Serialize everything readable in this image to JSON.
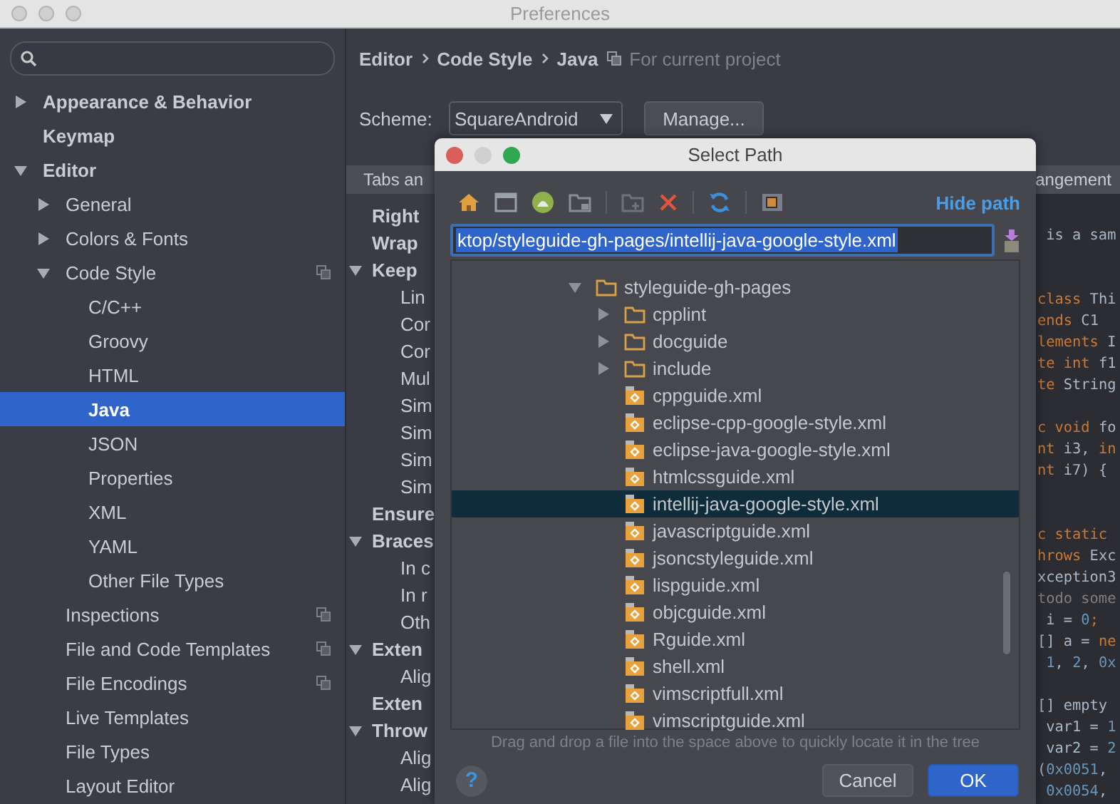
{
  "window": {
    "title": "Preferences"
  },
  "sidebar": {
    "items": [
      {
        "label": "Appearance & Behavior",
        "expanded": false,
        "selected": false,
        "project_scope": false
      },
      {
        "label": "Keymap",
        "selected": false,
        "project_scope": false
      },
      {
        "label": "Editor",
        "expanded": true,
        "selected": false,
        "project_scope": false,
        "children": [
          {
            "label": "General",
            "expanded": false,
            "selected": false,
            "project_scope": false
          },
          {
            "label": "Colors & Fonts",
            "expanded": false,
            "selected": false,
            "project_scope": false
          },
          {
            "label": "Code Style",
            "expanded": true,
            "selected": false,
            "project_scope": true,
            "children": [
              {
                "label": "C/C++",
                "selected": false,
                "project_scope": false
              },
              {
                "label": "Groovy",
                "selected": false,
                "project_scope": false
              },
              {
                "label": "HTML",
                "selected": false,
                "project_scope": false
              },
              {
                "label": "Java",
                "selected": true,
                "project_scope": false
              },
              {
                "label": "JSON",
                "selected": false,
                "project_scope": false
              },
              {
                "label": "Properties",
                "selected": false,
                "project_scope": false
              },
              {
                "label": "XML",
                "selected": false,
                "project_scope": false
              },
              {
                "label": "YAML",
                "selected": false,
                "project_scope": false
              },
              {
                "label": "Other File Types",
                "selected": false,
                "project_scope": false
              }
            ]
          },
          {
            "label": "Inspections",
            "selected": false,
            "project_scope": true
          },
          {
            "label": "File and Code Templates",
            "selected": false,
            "project_scope": true
          },
          {
            "label": "File Encodings",
            "selected": false,
            "project_scope": true
          },
          {
            "label": "Live Templates",
            "selected": false,
            "project_scope": false
          },
          {
            "label": "File Types",
            "selected": false,
            "project_scope": false
          },
          {
            "label": "Layout Editor",
            "selected": false,
            "project_scope": false
          }
        ]
      }
    ]
  },
  "breadcrumb": [
    "Editor",
    "Code Style",
    "Java"
  ],
  "scope_note": "For current project",
  "scheme": {
    "label": "Scheme:",
    "value": "SquareAndroid",
    "manage_button": "Manage..."
  },
  "tabs": [
    {
      "label": "Tabs an",
      "selected": false
    },
    {
      "label": "angement",
      "selected": false
    }
  ],
  "settings": [
    {
      "label": "Right"
    },
    {
      "label": "Wrap"
    },
    {
      "label": "Keep",
      "expanded": true,
      "children": [
        {
          "label": "Lin"
        },
        {
          "label": "Cor"
        },
        {
          "label": "Cor"
        },
        {
          "label": "Mul"
        },
        {
          "label": "Sim"
        },
        {
          "label": "Sim"
        },
        {
          "label": "Sim"
        },
        {
          "label": "Sim"
        }
      ]
    },
    {
      "label": "Ensure"
    },
    {
      "label": "Braces",
      "expanded": true,
      "children": [
        {
          "label": "In c"
        },
        {
          "label": "In r"
        },
        {
          "label": "Oth"
        }
      ]
    },
    {
      "label": "Exten",
      "expanded": true,
      "children": [
        {
          "label": "Alig"
        }
      ]
    },
    {
      "label": "Exten"
    },
    {
      "label": "Throw",
      "expanded": true,
      "children": [
        {
          "label": "Alig"
        },
        {
          "label": "Alig"
        }
      ]
    }
  ],
  "code_lines": [
    {
      "kind": "code",
      "segments": [
        {
          "kind": "plain",
          "text": " is a sam"
        }
      ]
    },
    {
      "kind": "blank"
    },
    {
      "kind": "blank"
    },
    {
      "kind": "code",
      "segments": [
        {
          "kind": "keyword",
          "text": "class"
        },
        {
          "kind": "plain",
          "text": " Thi"
        }
      ]
    },
    {
      "kind": "code",
      "segments": [
        {
          "kind": "keyword",
          "text": "ends"
        },
        {
          "kind": "plain",
          "text": " C1"
        }
      ]
    },
    {
      "kind": "code",
      "segments": [
        {
          "kind": "keyword",
          "text": "lements"
        },
        {
          "kind": "plain",
          "text": " I"
        }
      ]
    },
    {
      "kind": "code",
      "segments": [
        {
          "kind": "keyword",
          "text": "te int"
        },
        {
          "kind": "plain",
          "text": " f1"
        }
      ]
    },
    {
      "kind": "code",
      "segments": [
        {
          "kind": "keyword",
          "text": "te"
        },
        {
          "kind": "plain",
          "text": " String"
        }
      ]
    },
    {
      "kind": "blank"
    },
    {
      "kind": "code",
      "segments": [
        {
          "kind": "keyword",
          "text": "c void"
        },
        {
          "kind": "plain",
          "text": " fo"
        }
      ]
    },
    {
      "kind": "code",
      "segments": [
        {
          "kind": "keyword",
          "text": "nt"
        },
        {
          "kind": "plain",
          "text": " i3, "
        },
        {
          "kind": "keyword",
          "text": "in"
        }
      ]
    },
    {
      "kind": "code",
      "segments": [
        {
          "kind": "keyword",
          "text": "nt"
        },
        {
          "kind": "plain",
          "text": " i7) {"
        }
      ]
    },
    {
      "kind": "blank"
    },
    {
      "kind": "blank"
    },
    {
      "kind": "code",
      "segments": [
        {
          "kind": "keyword",
          "text": "c static"
        }
      ]
    },
    {
      "kind": "code",
      "segments": [
        {
          "kind": "keyword",
          "text": "hrows"
        },
        {
          "kind": "plain",
          "text": " Exc"
        }
      ]
    },
    {
      "kind": "code",
      "segments": [
        {
          "kind": "plain",
          "text": "xception3"
        }
      ]
    },
    {
      "kind": "code",
      "segments": [
        {
          "kind": "comment",
          "text": "todo some"
        }
      ]
    },
    {
      "kind": "code",
      "segments": [
        {
          "kind": "plain",
          "text": " i = "
        },
        {
          "kind": "number",
          "text": "0"
        },
        {
          "kind": "keyword",
          "text": ";"
        }
      ]
    },
    {
      "kind": "code",
      "segments": [
        {
          "kind": "plain",
          "text": "[] a = "
        },
        {
          "kind": "keyword",
          "text": "ne"
        }
      ]
    },
    {
      "kind": "code",
      "segments": [
        {
          "kind": "number",
          "text": " 1"
        },
        {
          "kind": "plain",
          "text": ", "
        },
        {
          "kind": "number",
          "text": "2"
        },
        {
          "kind": "plain",
          "text": ", "
        },
        {
          "kind": "number",
          "text": "0x"
        }
      ]
    },
    {
      "kind": "blank"
    },
    {
      "kind": "code",
      "segments": [
        {
          "kind": "plain",
          "text": "[] empty"
        }
      ]
    },
    {
      "kind": "code",
      "segments": [
        {
          "kind": "plain",
          "text": " var1 = "
        },
        {
          "kind": "number",
          "text": "1"
        }
      ]
    },
    {
      "kind": "code",
      "segments": [
        {
          "kind": "plain",
          "text": " var2 = "
        },
        {
          "kind": "number",
          "text": "2"
        }
      ]
    },
    {
      "kind": "code",
      "segments": [
        {
          "kind": "plain",
          "text": "("
        },
        {
          "kind": "number",
          "text": "0x0051"
        },
        {
          "kind": "plain",
          "text": ","
        }
      ]
    },
    {
      "kind": "code",
      "segments": [
        {
          "kind": "number",
          "text": " 0x0054"
        },
        {
          "kind": "plain",
          "text": ","
        }
      ]
    }
  ],
  "dialog": {
    "title": "Select Path",
    "hide_path_link": "Hide path",
    "path": "ktop/styleguide-gh-pages/intellij-java-google-style.xml",
    "tree": [
      {
        "label": "styleguide-gh-pages",
        "kind": "folder",
        "expanded": true,
        "selected": false,
        "children": [
          {
            "label": "cpplint",
            "kind": "folder",
            "expanded": false,
            "selected": false
          },
          {
            "label": "docguide",
            "kind": "folder",
            "expanded": false,
            "selected": false
          },
          {
            "label": "include",
            "kind": "folder",
            "expanded": false,
            "selected": false
          },
          {
            "label": "cppguide.xml",
            "kind": "file",
            "selected": false
          },
          {
            "label": "eclipse-cpp-google-style.xml",
            "kind": "file",
            "selected": false
          },
          {
            "label": "eclipse-java-google-style.xml",
            "kind": "file",
            "selected": false
          },
          {
            "label": "htmlcssguide.xml",
            "kind": "file",
            "selected": false
          },
          {
            "label": "intellij-java-google-style.xml",
            "kind": "file",
            "selected": true
          },
          {
            "label": "javascriptguide.xml",
            "kind": "file",
            "selected": false
          },
          {
            "label": "jsoncstyleguide.xml",
            "kind": "file",
            "selected": false
          },
          {
            "label": "lispguide.xml",
            "kind": "file",
            "selected": false
          },
          {
            "label": "objcguide.xml",
            "kind": "file",
            "selected": false
          },
          {
            "label": "Rguide.xml",
            "kind": "file",
            "selected": false
          },
          {
            "label": "shell.xml",
            "kind": "file",
            "selected": false
          },
          {
            "label": "vimscriptfull.xml",
            "kind": "file",
            "selected": false
          },
          {
            "label": "vimscriptguide.xml",
            "kind": "file",
            "selected": false
          }
        ]
      }
    ],
    "hint": "Drag and drop a file into the space above to quickly locate it in the tree",
    "help_button": "?",
    "cancel_button": "Cancel",
    "ok_button": "OK"
  }
}
